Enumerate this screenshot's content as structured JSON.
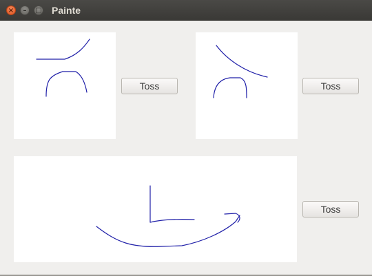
{
  "window": {
    "title": "Painte",
    "controls": {
      "close": "×",
      "minimize": "–",
      "maximize": "□"
    }
  },
  "panels": [
    {
      "id": "top-left",
      "button_label": "Toss"
    },
    {
      "id": "top-right",
      "button_label": "Toss"
    },
    {
      "id": "bottom",
      "button_label": "Toss"
    }
  ],
  "colors": {
    "stroke": "#1f1fa8",
    "canvas": "#ffffff",
    "window_bg": "#f0efed"
  }
}
